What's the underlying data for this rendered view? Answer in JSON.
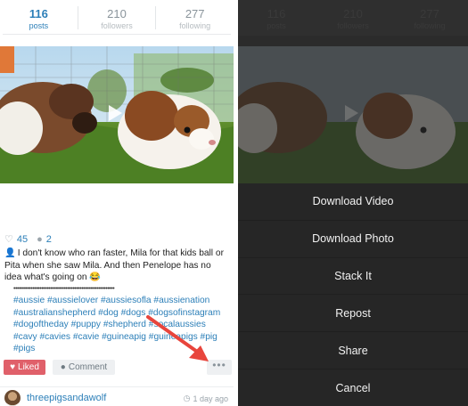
{
  "profile_stats": [
    {
      "value": "116",
      "label": "posts",
      "active": true
    },
    {
      "value": "210",
      "label": "followers",
      "active": false
    },
    {
      "value": "277",
      "label": "following",
      "active": false
    }
  ],
  "post": {
    "like_count": "45",
    "comment_count": "2",
    "caption": "I don't know who ran faster, Mila for that kids ball or Pita when she saw Mila. And then Penelope has no idea what's going on 😂",
    "separator": "••••••••••••••••••••••••••••••••••••••••••••••••••••••••••",
    "hashtags": "#aussie #aussielover #aussiesofla #aussienation #australianshepherd #dog #dogs #dogsofinstagram #dogoftheday #puppy #shepherd #socalaussies #cavy #cavies #cavie #guineapig #guineapigs #pig #pigs",
    "liked_label": "Liked",
    "comment_label": "Comment",
    "more_label": "•••",
    "author": "threepigsandawolf",
    "time": "1 day ago"
  },
  "action_sheet": {
    "items": [
      "Download Video",
      "Download Photo",
      "Stack It",
      "Repost",
      "Share",
      "Cancel"
    ]
  },
  "colors": {
    "accent": "#2c7fb8",
    "liked": "#e0606a",
    "arrow": "#e8453c",
    "sheet_bg": "#262626"
  }
}
